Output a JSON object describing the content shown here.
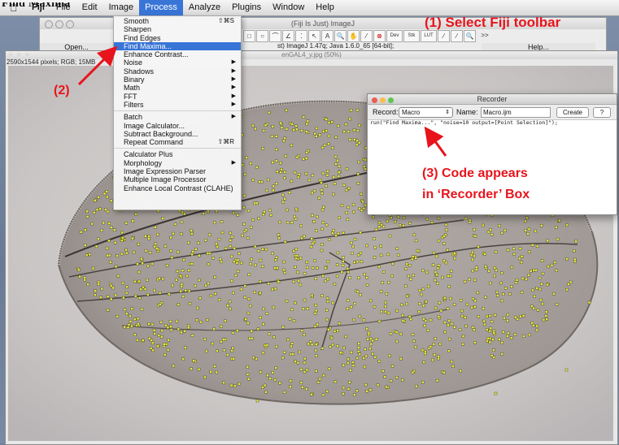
{
  "page": {
    "partial_title": "Find Maxima"
  },
  "menubar": {
    "items": [
      "Fiji",
      "File",
      "Edit",
      "Image",
      "Process",
      "Analyze",
      "Plugins",
      "Window",
      "Help"
    ],
    "active": "Process"
  },
  "toolbar_window": {
    "title": "(Fiji Is Just) ImageJ",
    "open_label": "Open...",
    "help_label": "Help...",
    "status": "st) ImageJ 1.47q; Java 1.6.0_65 [64-bit];",
    "tool_glyphs": [
      "□",
      "○",
      "⌒",
      "∠",
      "⁚",
      "↖",
      "A",
      "🔍",
      "✋",
      "⁄",
      "⊗",
      "Dev",
      "Stk",
      "LUT",
      "⁄",
      "⁄",
      "🔍"
    ],
    "more_label": ">>"
  },
  "image_window": {
    "title": "enGAL4_y.jpg (50%)",
    "info": "2590x1544 pixels; RGB; 15MB"
  },
  "process_menu": {
    "items": [
      {
        "label": "Smooth",
        "shortcut": "⇧⌘S"
      },
      {
        "label": "Sharpen"
      },
      {
        "label": "Find Edges"
      },
      {
        "label": "Find Maxima...",
        "selected": true
      },
      {
        "label": "Enhance Contrast..."
      },
      {
        "label": "Noise",
        "submenu": true
      },
      {
        "label": "Shadows",
        "submenu": true
      },
      {
        "label": "Binary",
        "submenu": true
      },
      {
        "label": "Math",
        "submenu": true
      },
      {
        "label": "FFT",
        "submenu": true
      },
      {
        "label": "Filters",
        "submenu": true
      },
      {
        "separator": true
      },
      {
        "label": "Batch",
        "submenu": true
      },
      {
        "label": "Image Calculator..."
      },
      {
        "label": "Subtract Background..."
      },
      {
        "label": "Repeat Command",
        "shortcut": "⇧⌘R"
      },
      {
        "separator": true
      },
      {
        "label": "Calculator Plus"
      },
      {
        "label": "Morphology",
        "submenu": true
      },
      {
        "label": "Image Expression Parser"
      },
      {
        "label": "Multiple Image Processor"
      },
      {
        "label": "Enhance Local Contrast (CLAHE)"
      }
    ]
  },
  "recorder": {
    "title": "Recorder",
    "record_label": "Record:",
    "record_value": "Macro",
    "name_label": "Name:",
    "name_value": "Macro.ijm",
    "create_label": "Create",
    "help_label": "?",
    "code": "run(\"Find Maxima...\", \"noise=10 output=[Point Selection]\");"
  },
  "callouts": {
    "step1": "(1) Select Fiji toolbar",
    "step2": "(2)",
    "step3_line1": "(3) Code appears",
    "step3_line2": "in ‘Recorder’ Box"
  },
  "colors": {
    "callout": "#e8141c",
    "menu_highlight": "#3875d7",
    "maxima_points": "#e6e64a"
  }
}
